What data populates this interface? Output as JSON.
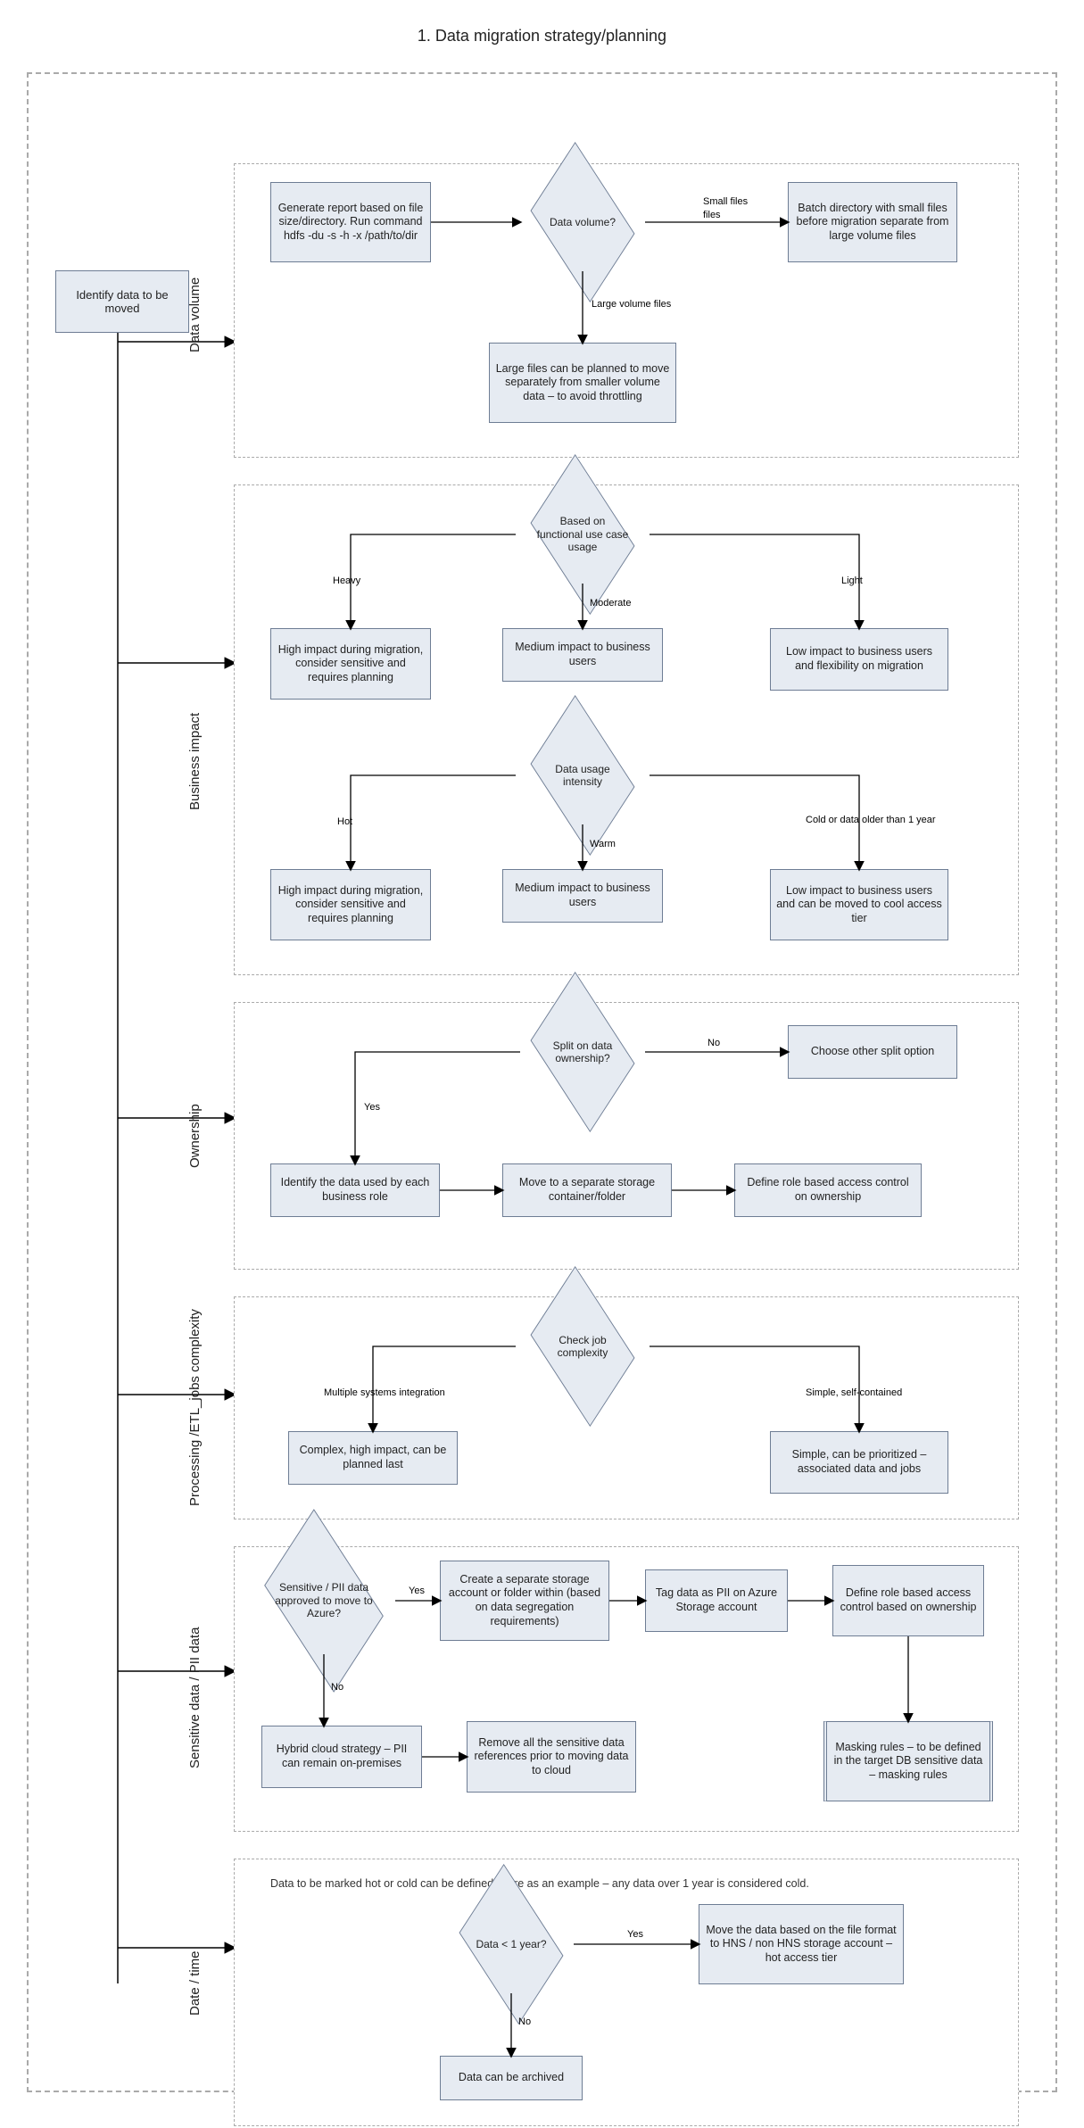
{
  "title": "1. Data migration strategy/planning",
  "start": "Identify data to be moved",
  "sections": {
    "datavolume": {
      "label": "Data volume",
      "decision": "Data volume?",
      "edge_small": "Small files",
      "edge_large": "Large volume files",
      "n1": "Generate report based on file size/directory. Run command hdfs -du -s -h -x /path/to/dir",
      "n2": "Batch directory with small files before migration separate from large volume files",
      "n3": "Large files can be planned to move separately from smaller volume data – to avoid throttling"
    },
    "bizimpact": {
      "label": "Business impact",
      "dec1": "Based on functional use case usage",
      "dec2": "Data usage intensity",
      "e_heavy": "Heavy",
      "e_mod": "Moderate",
      "e_light": "Light",
      "e_hot": "Hot",
      "e_warm": "Warm",
      "e_cold": "Cold or data older than 1 year",
      "b1": "High impact during migration, consider sensitive and requires planning",
      "b2": "Medium impact to business users",
      "b3": "Low impact to business users and flexibility on migration",
      "b4": "High impact during migration, consider sensitive and requires planning",
      "b5": "Medium impact to business users",
      "b6": "Low impact to business users and can be moved to cool access tier"
    },
    "ownership": {
      "label": "Ownership",
      "dec": "Split on data ownership?",
      "e_yes": "Yes",
      "e_no": "No",
      "o1": "Identify the data used by each business role",
      "o2": "Move to a separate storage container/folder",
      "o3": "Define role based access control on ownership",
      "o4": "Choose other split option"
    },
    "etl": {
      "label": "Processing /ETL_jobs complexity",
      "dec": "Check job complexity",
      "e_multi": "Multiple systems integration",
      "e_simple": "Simple, self-contained",
      "p1": "Complex, high impact, can be planned last",
      "p2": "Simple, can be prioritized – associated data and jobs"
    },
    "pii": {
      "label": "Sensitive data / PII data",
      "dec": "Sensitive / PII data approved to move to Azure?",
      "e_yes": "Yes",
      "e_no": "No",
      "s1": "Create a separate storage account or folder within (based on data segregation requirements)",
      "s2": "Tag data as PII on Azure Storage account",
      "s3": "Define role based access control based on ownership",
      "s4": "Hybrid cloud strategy – PII can remain on-premises",
      "s5": "Remove all the sensitive data references prior to moving data to cloud",
      "s6": "Masking rules – to be defined in the target DB sensitive data – masking rules"
    },
    "datetime": {
      "label": "Date / time",
      "note": "Data to be marked hot or cold can be defined. Here as an example – any data over 1 year is considered cold.",
      "dec": "Data < 1 year?",
      "e_yes": "Yes",
      "e_no": "No",
      "d1": "Move the data based on the file format to HNS / non HNS storage account – hot access tier",
      "d2": "Data can be archived"
    }
  }
}
